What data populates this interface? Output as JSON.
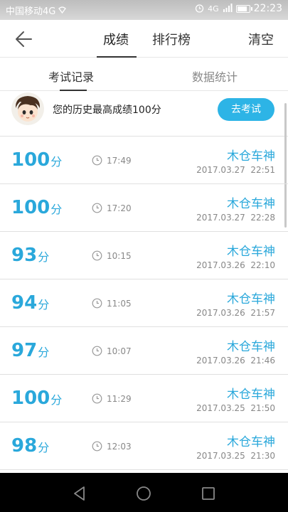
{
  "status_bar": {
    "carrier": "中国移动4G",
    "network": "4G",
    "time": "22:23",
    "battery_level": 0.85
  },
  "header": {
    "tabs": [
      {
        "label": "成绩",
        "active": true
      },
      {
        "label": "排行榜",
        "active": false
      }
    ],
    "clear_label": "清空"
  },
  "sub_tabs": [
    {
      "label": "考试记录",
      "active": true
    },
    {
      "label": "数据统计",
      "active": false
    }
  ],
  "best": {
    "text": "您的历史最高成绩100分",
    "button_label": "去考试"
  },
  "records": [
    {
      "score": "100",
      "unit": "分",
      "duration": "17:49",
      "user": "木仓车神",
      "datetime": "2017.03.27  22:51"
    },
    {
      "score": "100",
      "unit": "分",
      "duration": "17:20",
      "user": "木仓车神",
      "datetime": "2017.03.27  22:28"
    },
    {
      "score": "93",
      "unit": "分",
      "duration": "10:15",
      "user": "木仓车神",
      "datetime": "2017.03.26  22:10"
    },
    {
      "score": "94",
      "unit": "分",
      "duration": "11:05",
      "user": "木仓车神",
      "datetime": "2017.03.26  21:57"
    },
    {
      "score": "97",
      "unit": "分",
      "duration": "10:07",
      "user": "木仓车神",
      "datetime": "2017.03.26  21:46"
    },
    {
      "score": "100",
      "unit": "分",
      "duration": "11:29",
      "user": "木仓车神",
      "datetime": "2017.03.25  21:50"
    },
    {
      "score": "98",
      "unit": "分",
      "duration": "12:03",
      "user": "木仓车神",
      "datetime": "2017.03.25  21:30"
    }
  ],
  "colors": {
    "accent": "#2aa8db",
    "button": "#2db4e6"
  }
}
